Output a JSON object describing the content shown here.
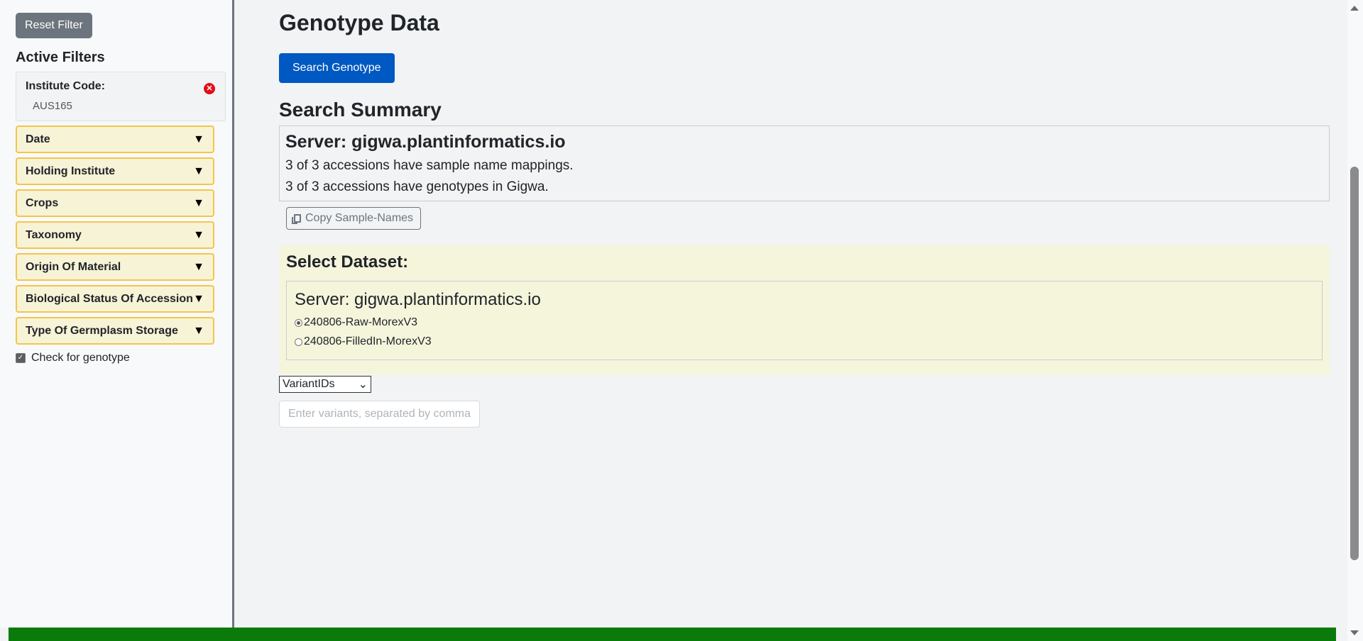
{
  "sidebar": {
    "reset_label": "Reset Filter",
    "active_filters_title": "Active Filters",
    "active_filter": {
      "key": "Institute Code:",
      "value": "AUS165"
    },
    "filters": [
      {
        "label": "Date"
      },
      {
        "label": "Holding Institute"
      },
      {
        "label": "Crops"
      },
      {
        "label": "Taxonomy"
      },
      {
        "label": "Origin Of Material"
      },
      {
        "label": "Biological Status Of Accession"
      },
      {
        "label": "Type Of Germplasm Storage"
      }
    ],
    "check_genotype_label": "Check for genotype",
    "check_genotype_checked": true
  },
  "main": {
    "title": "Genotype Data",
    "search_button": "Search Genotype",
    "summary_title": "Search Summary",
    "summary": {
      "server": "Server: gigwa.plantinformatics.io",
      "lines": [
        "3 of 3 accessions have sample name mappings.",
        "3 of 3 accessions have genotypes in Gigwa."
      ]
    },
    "copy_button": "Copy Sample-Names",
    "dataset": {
      "title": "Select Dataset:",
      "server": "Server: gigwa.plantinformatics.io",
      "options": [
        {
          "label": "240806-Raw-MorexV3",
          "selected": true
        },
        {
          "label": "240806-FilledIn-MorexV3",
          "selected": false
        }
      ]
    },
    "variant_select": "VariantIDs",
    "variant_input_placeholder": "Enter variants, separated by commas"
  },
  "colors": {
    "reset_button": "#6c757d",
    "search_button": "#0058c2",
    "filter_border": "#f3c64a",
    "filter_bg": "#f7f3d6",
    "dataset_bg": "#f5f5dc",
    "footer": "#0a7b0a",
    "remove_icon": "#e30d18"
  }
}
